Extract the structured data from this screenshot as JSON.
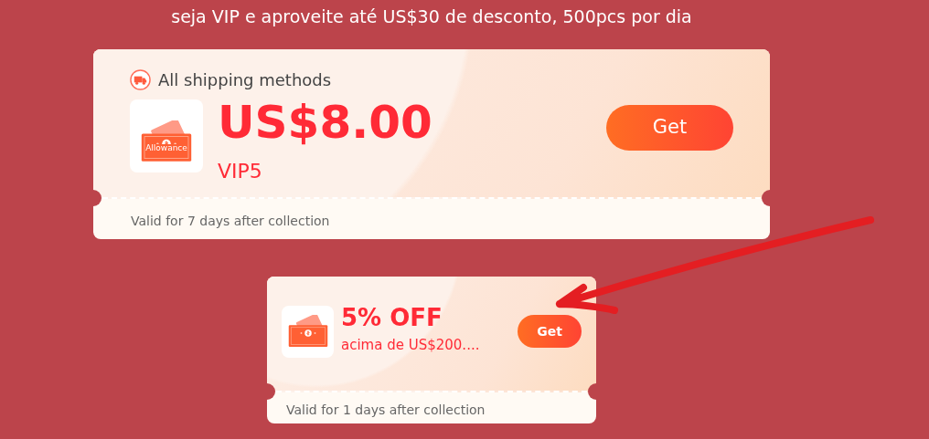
{
  "promo_text": "seja VIP e aproveite até US$30 de desconto, 500pcs por dia",
  "coupons": [
    {
      "kind": "large",
      "scope": "All shipping methods",
      "icon_label": "Allowance",
      "amount": "US$8.00",
      "condition": "VIP5",
      "button": "Get",
      "validity": "Valid for 7 days after collection"
    },
    {
      "kind": "small",
      "amount": "5% OFF",
      "condition": "acima de US$200....",
      "button": "Get",
      "validity": "Valid for 1 days after collection"
    }
  ]
}
